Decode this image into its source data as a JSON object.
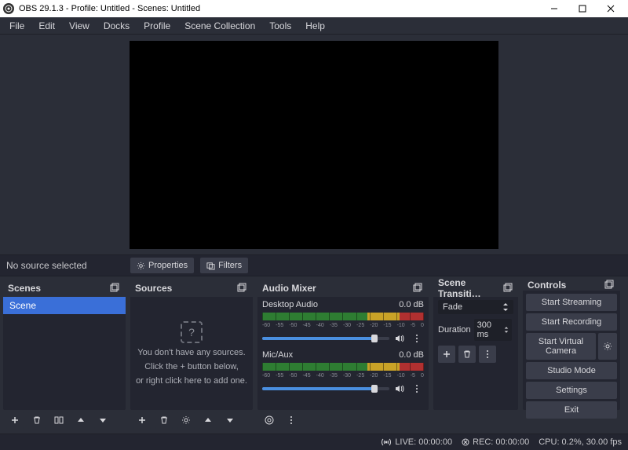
{
  "window": {
    "title": "OBS 29.1.3 - Profile: Untitled - Scenes: Untitled"
  },
  "menu": [
    "File",
    "Edit",
    "View",
    "Docks",
    "Profile",
    "Scene Collection",
    "Tools",
    "Help"
  ],
  "sourcebar": {
    "status": "No source selected",
    "properties": "Properties",
    "filters": "Filters"
  },
  "panels": {
    "scenes": {
      "title": "Scenes",
      "items": [
        "Scene"
      ]
    },
    "sources": {
      "title": "Sources",
      "empty_line1": "You don't have any sources.",
      "empty_line2": "Click the + button below,",
      "empty_line3": "or right click here to add one."
    },
    "mixer": {
      "title": "Audio Mixer",
      "channels": [
        {
          "name": "Desktop Audio",
          "level": "0.0 dB"
        },
        {
          "name": "Mic/Aux",
          "level": "0.0 dB"
        }
      ],
      "ticks": [
        "-60",
        "-55",
        "-50",
        "-45",
        "-40",
        "-35",
        "-30",
        "-25",
        "-20",
        "-15",
        "-10",
        "-5",
        "0"
      ]
    },
    "transitions": {
      "title": "Scene Transiti…",
      "selected": "Fade",
      "duration_label": "Duration",
      "duration_value": "300 ms"
    },
    "controls": {
      "title": "Controls",
      "buttons": {
        "stream": "Start Streaming",
        "record": "Start Recording",
        "vcam": "Start Virtual Camera",
        "studio": "Studio Mode",
        "settings": "Settings",
        "exit": "Exit"
      }
    }
  },
  "status": {
    "live": "LIVE: 00:00:00",
    "rec": "REC: 00:00:00",
    "cpu": "CPU: 0.2%, 30.00 fps"
  }
}
